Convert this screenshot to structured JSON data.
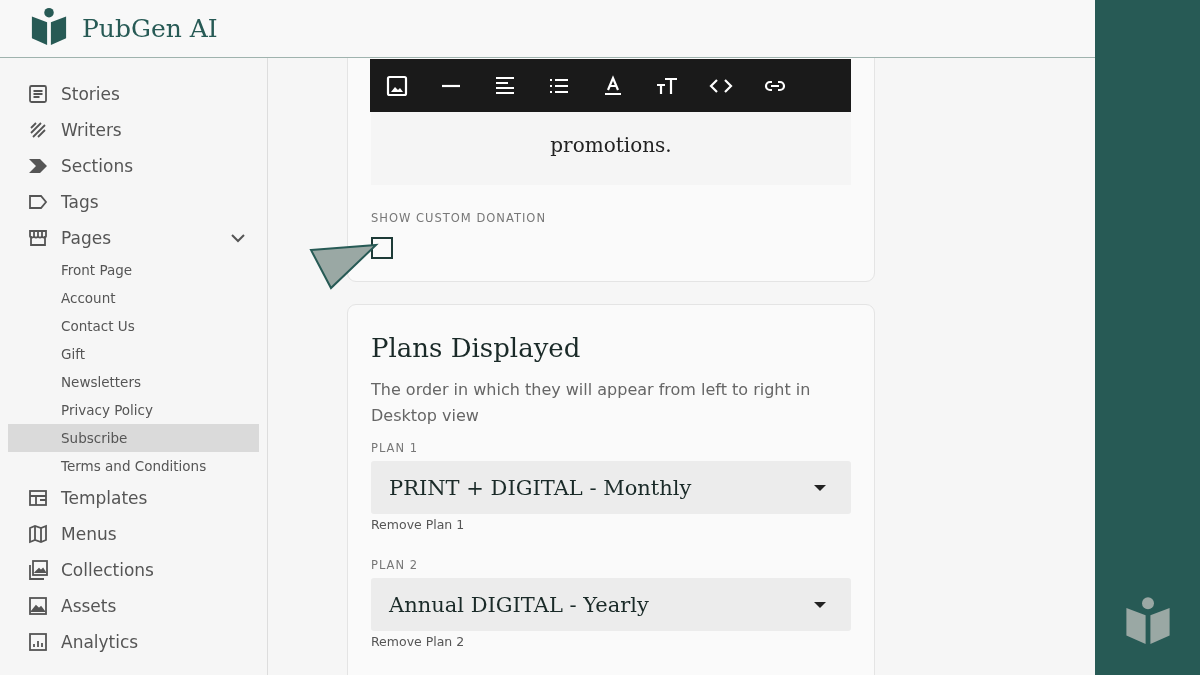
{
  "brand": {
    "name": "PubGen AI"
  },
  "sidebar": {
    "items": [
      {
        "label": "Stories",
        "selected": false
      },
      {
        "label": "Writers",
        "selected": false
      },
      {
        "label": "Sections",
        "selected": false
      },
      {
        "label": "Tags",
        "selected": false
      },
      {
        "label": "Pages",
        "selected": false,
        "expanded": true,
        "children": [
          {
            "label": "Front Page",
            "selected": false
          },
          {
            "label": "Account",
            "selected": false
          },
          {
            "label": "Contact Us",
            "selected": false
          },
          {
            "label": "Gift",
            "selected": false
          },
          {
            "label": "Newsletters",
            "selected": false
          },
          {
            "label": "Privacy Policy",
            "selected": false
          },
          {
            "label": "Subscribe",
            "selected": true
          },
          {
            "label": "Terms and Conditions",
            "selected": false
          }
        ]
      },
      {
        "label": "Templates",
        "selected": false
      },
      {
        "label": "Menus",
        "selected": false
      },
      {
        "label": "Collections",
        "selected": false
      },
      {
        "label": "Assets",
        "selected": false
      },
      {
        "label": "Analytics",
        "selected": false
      }
    ]
  },
  "editor": {
    "lines": [
      "promotions."
    ]
  },
  "custom_donation": {
    "label": "SHOW CUSTOM DONATION",
    "checked": false
  },
  "plans_card": {
    "title": "Plans Displayed",
    "description": "The order in which they will appear from left to right in Desktop view",
    "plans": [
      {
        "label": "PLAN 1",
        "value": "PRINT + DIGITAL - Monthly",
        "remove": "Remove Plan 1"
      },
      {
        "label": "PLAN 2",
        "value": "Annual DIGITAL - Yearly",
        "remove": "Remove Plan 2"
      }
    ]
  }
}
